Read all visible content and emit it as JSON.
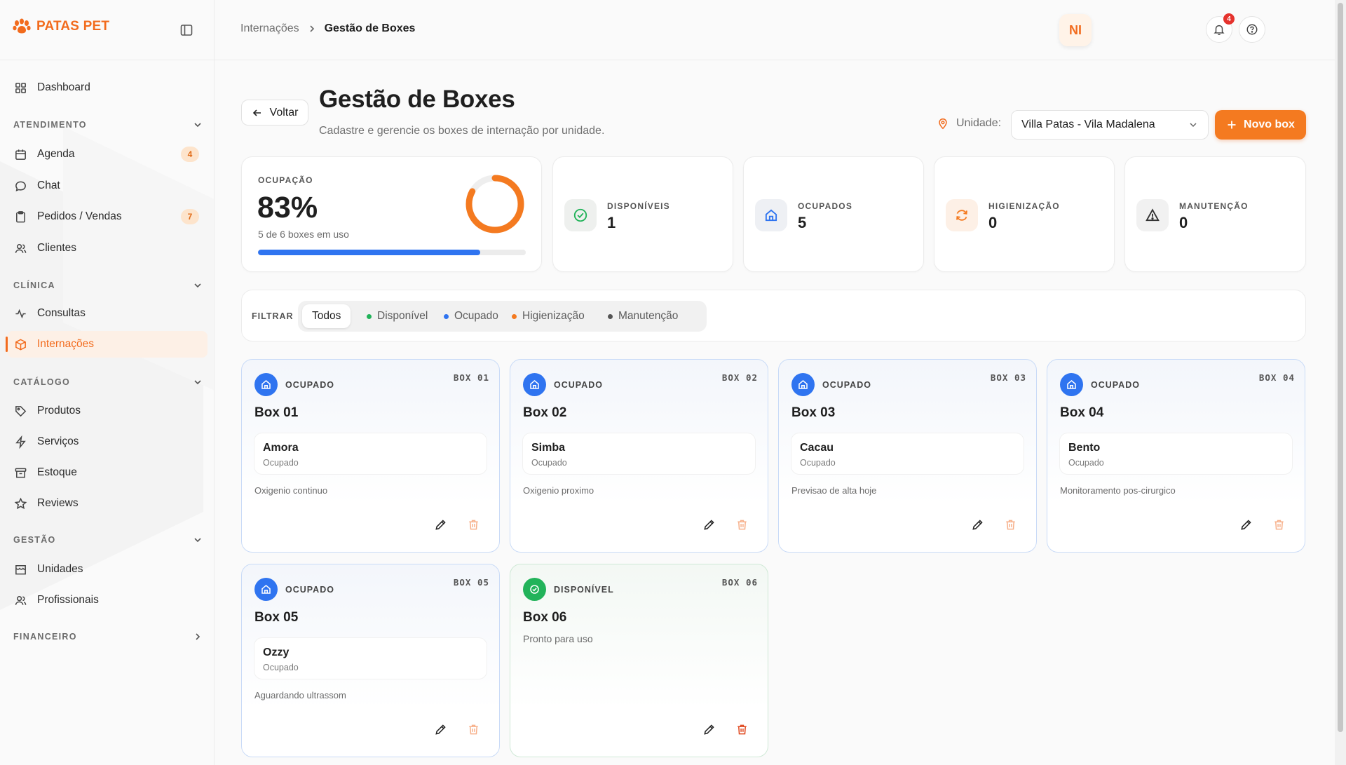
{
  "brand": {
    "name": "PATAS PET"
  },
  "sidebar": {
    "dashboard": "Dashboard",
    "sections": [
      {
        "title": "ATENDIMENTO"
      },
      {
        "title": "CLÍNICA"
      },
      {
        "title": "CATÁLOGO"
      },
      {
        "title": "GESTÃO"
      },
      {
        "title": "FINANCEIRO"
      }
    ],
    "items": {
      "agenda": {
        "label": "Agenda",
        "badge": "4"
      },
      "chat": {
        "label": "Chat"
      },
      "pedidos": {
        "label": "Pedidos / Vendas",
        "badge": "7"
      },
      "clientes": {
        "label": "Clientes"
      },
      "consultas": {
        "label": "Consultas"
      },
      "internacoes": {
        "label": "Internações"
      },
      "produtos": {
        "label": "Produtos"
      },
      "servicos": {
        "label": "Serviços"
      },
      "estoque": {
        "label": "Estoque"
      },
      "reviews": {
        "label": "Reviews"
      },
      "unidades": {
        "label": "Unidades"
      },
      "profissionais": {
        "label": "Profissionais"
      }
    }
  },
  "topbar": {
    "breadcrumb": [
      "Internações",
      "Gestão de Boxes"
    ],
    "notifications": "4",
    "avatar": "NI"
  },
  "header": {
    "back": "Voltar",
    "title": "Gestão de Boxes",
    "subtitle": "Cadastre e gerencie os boxes de internação por unidade.",
    "unit_label": "Unidade:",
    "unit_value": "Villa Patas - Vila Madalena",
    "new_button": "Novo box"
  },
  "stats": {
    "occupancy": {
      "label": "OCUPAÇÃO",
      "value": "83%",
      "sub": "5 de 6 boxes em uso",
      "fraction": 0.83
    },
    "cards": [
      {
        "label": "DISPONÍVEIS",
        "value": "1"
      },
      {
        "label": "OCUPADOS",
        "value": "5"
      },
      {
        "label": "HIGIENIZAÇÃO",
        "value": "0"
      },
      {
        "label": "MANUTENÇÃO",
        "value": "0"
      }
    ]
  },
  "filter": {
    "label": "FILTRAR",
    "options": [
      "Todos",
      "Disponível",
      "Ocupado",
      "Higienização",
      "Manutenção"
    ],
    "active": "Todos"
  },
  "colors": {
    "accent": "#f26b1d",
    "available": "#22b35a",
    "occupied": "#2f74f0",
    "cleaning": "#f47a20",
    "maintenance": "#555555"
  },
  "boxes": [
    {
      "status": "OCUPADO",
      "code": "BOX 01",
      "title": "Box 01",
      "pet": "Amora",
      "pet_status": "Ocupado",
      "note": "Oxigenio continuo"
    },
    {
      "status": "OCUPADO",
      "code": "BOX 02",
      "title": "Box 02",
      "pet": "Simba",
      "pet_status": "Ocupado",
      "note": "Oxigenio proximo"
    },
    {
      "status": "OCUPADO",
      "code": "BOX 03",
      "title": "Box 03",
      "pet": "Cacau",
      "pet_status": "Ocupado",
      "note": "Previsao de alta hoje"
    },
    {
      "status": "OCUPADO",
      "code": "BOX 04",
      "title": "Box 04",
      "pet": "Bento",
      "pet_status": "Ocupado",
      "note": "Monitoramento pos-cirurgico"
    },
    {
      "status": "OCUPADO",
      "code": "BOX 05",
      "title": "Box 05",
      "pet": "Ozzy",
      "pet_status": "Ocupado",
      "note": "Aguardando ultrassom"
    },
    {
      "status": "DISPONÍVEL",
      "code": "BOX 06",
      "title": "Box 06",
      "note": "Pronto para uso"
    }
  ]
}
